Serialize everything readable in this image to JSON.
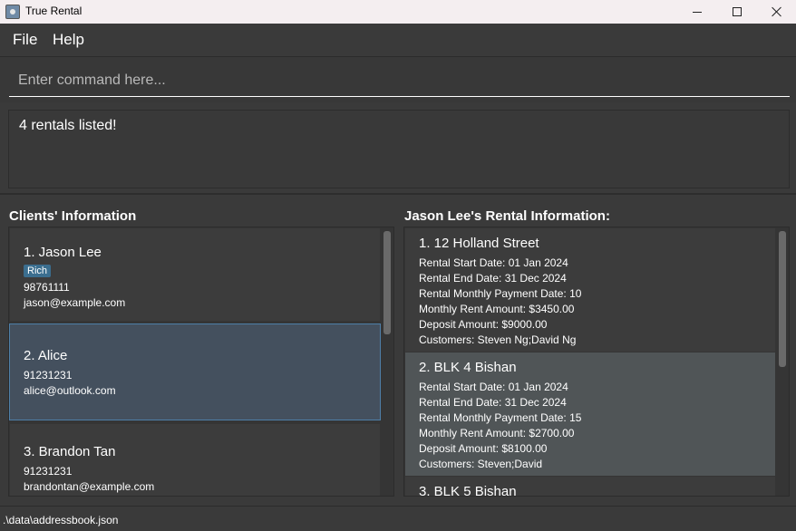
{
  "window": {
    "title": "True Rental",
    "minimize_icon": "minimize-icon",
    "maximize_icon": "maximize-icon",
    "close_icon": "close-icon"
  },
  "menu": {
    "file": "File",
    "help": "Help"
  },
  "command": {
    "placeholder": "Enter command here...",
    "value": ""
  },
  "result": {
    "message": "4 rentals listed!"
  },
  "clients": {
    "title": "Clients' Information",
    "items": [
      {
        "index_name": "1. Jason Lee",
        "tag": "Rich",
        "phone": "98761111",
        "email": "jason@example.com"
      },
      {
        "index_name": "2. Alice",
        "phone": "91231231",
        "email": "alice@outlook.com"
      },
      {
        "index_name": "3. Brandon Tan",
        "phone": "91231231",
        "email": "brandontan@example.com"
      }
    ]
  },
  "rentals": {
    "title": "Jason Lee's Rental Information:",
    "items": [
      {
        "index_address": "1. 12 Holland Street",
        "start": "Rental Start Date: 01 Jan 2024",
        "end": "Rental End Date: 31 Dec 2024",
        "payment_date": "Rental Monthly Payment Date: 10",
        "rent": "Monthly Rent Amount: $3450.00",
        "deposit": "Deposit Amount: $9000.00",
        "customers": "Customers: Steven Ng;David Ng"
      },
      {
        "index_address": "2. BLK 4 Bishan",
        "start": "Rental Start Date: 01 Jan 2024",
        "end": "Rental End Date: 31 Dec 2024",
        "payment_date": "Rental Monthly Payment Date: 15",
        "rent": "Monthly Rent Amount: $2700.00",
        "deposit": "Deposit Amount: $8100.00",
        "customers": "Customers: Steven;David"
      },
      {
        "index_address": "3. BLK 5 Bishan"
      }
    ]
  },
  "status": {
    "path": ".\\data\\addressbook.json"
  }
}
